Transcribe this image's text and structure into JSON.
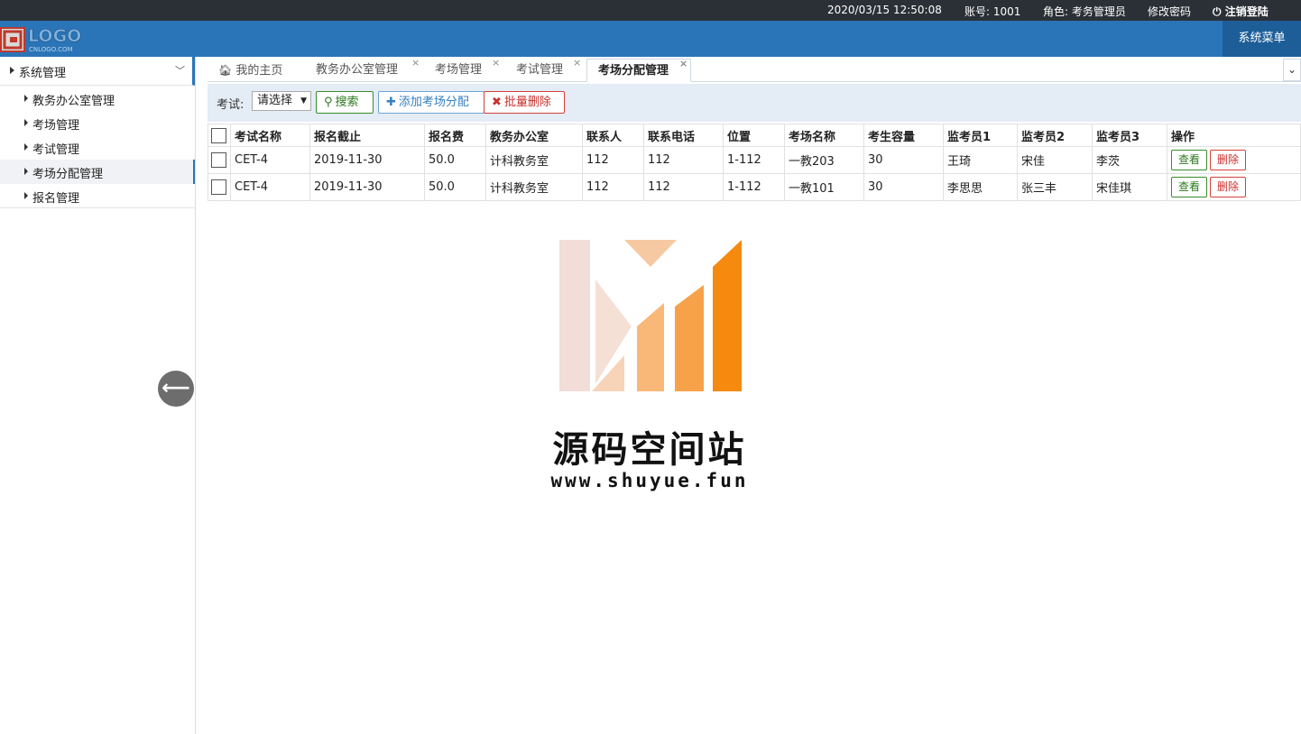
{
  "topbar": {
    "datetime": "2020/03/15 12:50:08",
    "account": "账号: 1001",
    "role": "角色: 考务管理员",
    "change_password": "修改密码",
    "logout": "注销登陆"
  },
  "header": {
    "logo_text": "LOGO",
    "logo_sub": "CNLOGO.COM",
    "system_menu": "系统菜单"
  },
  "sidebar": {
    "title": "系统管理",
    "items": [
      {
        "label": "教务办公室管理"
      },
      {
        "label": "考场管理"
      },
      {
        "label": "考试管理"
      },
      {
        "label": "考场分配管理"
      },
      {
        "label": "报名管理"
      }
    ]
  },
  "tabs": [
    {
      "label": "我的主页"
    },
    {
      "label": "教务办公室管理"
    },
    {
      "label": "考场管理"
    },
    {
      "label": "考试管理"
    },
    {
      "label": "考场分配管理"
    }
  ],
  "toolbar": {
    "exam_label": "考试:",
    "select_value": "请选择",
    "search": "搜索",
    "add": "添加考场分配",
    "batch_delete": "批量删除"
  },
  "table": {
    "columns": [
      "考试名称",
      "报名截止",
      "报名费",
      "教务办公室",
      "联系人",
      "联系电话",
      "位置",
      "考场名称",
      "考生容量",
      "监考员1",
      "监考员2",
      "监考员3",
      "操作"
    ],
    "rows": [
      [
        "CET-4",
        "2019-11-30",
        "50.0",
        "计科教务室",
        "112",
        "112",
        "1-112",
        "一教203",
        "30",
        "王琦",
        "宋佳",
        "李茨"
      ],
      [
        "CET-4",
        "2019-11-30",
        "50.0",
        "计科教务室",
        "112",
        "112",
        "1-112",
        "一教101",
        "30",
        "李思思",
        "张三丰",
        "宋佳琪"
      ]
    ],
    "view": "查看",
    "delete": "删除"
  },
  "watermark": {
    "title": "源码空间站",
    "url": "www.shuyue.fun"
  },
  "colors": {
    "topbar": "#2b3036",
    "header": "#2a75b8",
    "toolbar": "#e4ecf5",
    "success": "#2e7a1f",
    "danger": "#c9302c"
  }
}
